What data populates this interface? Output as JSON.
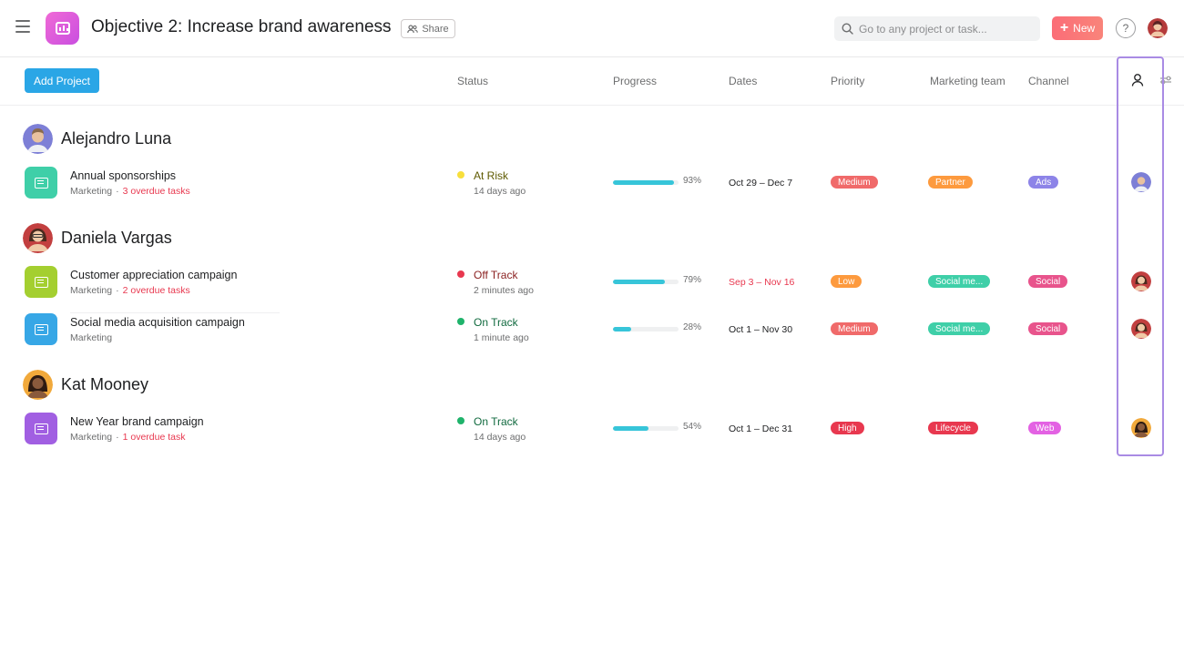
{
  "header": {
    "title": "Objective 2: Increase brand awareness",
    "share_label": "Share",
    "search_placeholder": "Go to any project or task...",
    "new_label": "New",
    "help_label": "?"
  },
  "toolbar": {
    "add_project_label": "Add Project"
  },
  "columns": {
    "status": "Status",
    "progress": "Progress",
    "dates": "Dates",
    "priority": "Priority",
    "marketing_team": "Marketing team",
    "channel": "Channel"
  },
  "groups": [
    {
      "name": "Alejandro Luna"
    },
    {
      "name": "Daniela Vargas"
    },
    {
      "name": "Kat Mooney"
    }
  ],
  "rows": [
    {
      "name": "Annual sponsorships",
      "team": "Marketing",
      "overdue": "3 overdue tasks",
      "icon_color": "#3fcfa8",
      "status": "At Risk",
      "status_color": "#f8df3c",
      "status_text_color": "#5f5a00",
      "status_time": "14 days ago",
      "progress_pct": "93%",
      "progress_value": 0.93,
      "dates": "Oct 29 – Dec 7",
      "dates_overdue": false,
      "priority": "Medium",
      "priority_color": "#f06a6a",
      "team_tag": "Partner",
      "team_tag_color": "#fd9a3e",
      "channel": "Ads",
      "channel_color": "#8d84e8"
    },
    {
      "name": "Customer appreciation campaign",
      "team": "Marketing",
      "overdue": "2 overdue tasks",
      "icon_color": "#a4cf30",
      "status": "Off Track",
      "status_color": "#e8384f",
      "status_text_color": "#8a1f1f",
      "status_time": "2 minutes ago",
      "progress_pct": "79%",
      "progress_value": 0.79,
      "dates": "Sep 3 – Nov 16",
      "dates_overdue": true,
      "priority": "Low",
      "priority_color": "#fd9a3e",
      "team_tag": "Social me...",
      "team_tag_color": "#3fcfa8",
      "channel": "Social",
      "channel_color": "#e8548c"
    },
    {
      "name": "Social media acquisition campaign",
      "team": "Marketing",
      "overdue": "",
      "icon_color": "#37a7e6",
      "status": "On Track",
      "status_color": "#1fb36b",
      "status_text_color": "#116a3f",
      "status_time": "1 minute ago",
      "progress_pct": "28%",
      "progress_value": 0.28,
      "dates": "Oct 1 – Nov 30",
      "dates_overdue": false,
      "priority": "Medium",
      "priority_color": "#f06a6a",
      "team_tag": "Social me...",
      "team_tag_color": "#3fcfa8",
      "channel": "Social",
      "channel_color": "#e8548c"
    },
    {
      "name": "New Year brand campaign",
      "team": "Marketing",
      "overdue": "1 overdue task",
      "icon_color": "#a15fe2",
      "status": "On Track",
      "status_color": "#1fb36b",
      "status_text_color": "#116a3f",
      "status_time": "14 days ago",
      "progress_pct": "54%",
      "progress_value": 0.54,
      "dates": "Oct 1 – Dec 31",
      "dates_overdue": false,
      "priority": "High",
      "priority_color": "#e8384f",
      "team_tag": "Lifecycle",
      "team_tag_color": "#e8384f",
      "channel": "Web",
      "channel_color": "#e362e3"
    }
  ],
  "colors": {
    "accent_blue": "#2aa6e6",
    "highlight_purple": "#a98be4",
    "progress_teal": "#37c5d9",
    "overdue_red": "#e8384f"
  }
}
